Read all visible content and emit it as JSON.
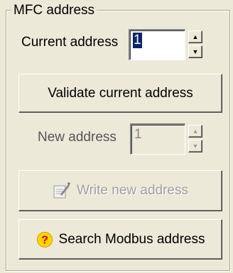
{
  "group": {
    "title": "MFC address"
  },
  "current_address": {
    "label": "Current address",
    "value": "1"
  },
  "validate_button": {
    "label": "Validate current address"
  },
  "new_address": {
    "label": "New address",
    "value": "1"
  },
  "write_button": {
    "label": "Write new address",
    "icon": "write-document-icon",
    "enabled": false
  },
  "search_button": {
    "label": "Search Modbus address",
    "icon": "question-mark-icon"
  },
  "colors": {
    "selection": "#0a246a",
    "face": "#ece9d8",
    "question_icon": "#ffd400"
  }
}
